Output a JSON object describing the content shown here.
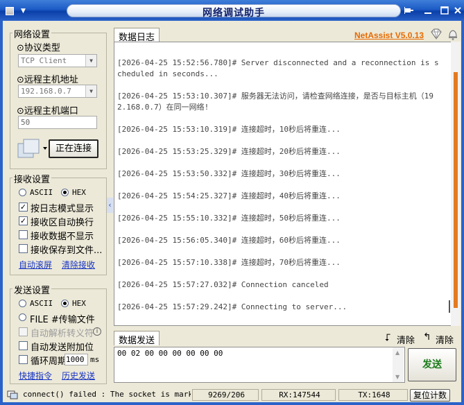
{
  "window": {
    "title": "网络调试助手",
    "brand": "NetAssist V5.0.13",
    "colors": {
      "titlebar": "#1c5bc6",
      "brand": "#e86a00",
      "send_button_text": "#1a7a1a",
      "link": "#1834c4"
    }
  },
  "network": {
    "title": "网络设置",
    "protocol_label": "⊙协议类型",
    "protocol_value": "TCP Client",
    "host_label": "⊙远程主机地址",
    "host_value": "192.168.0.7",
    "port_label": "⊙远程主机端口",
    "port_value": "50",
    "connect_button": "正在连接"
  },
  "receive": {
    "title": "接收设置",
    "ascii": "ASCII",
    "hex": "HEX",
    "opt_log_mode": "按日志模式显示",
    "opt_auto_wrap": "接收区自动换行",
    "opt_hide_data": "接收数据不显示",
    "opt_save_file": "接收保存到文件...",
    "link_auto_scroll": "自动滚屏",
    "link_clear": "清除接收"
  },
  "send": {
    "title": "发送设置",
    "ascii": "ASCII",
    "hex": "HEX",
    "file_label": "FILE #传输文件",
    "opt_escape": "自动解析转义符",
    "opt_append": "自动发送附加位",
    "opt_cycle": "循环周期",
    "cycle_value": "1000",
    "cycle_unit": "ms",
    "link_shortcuts": "快捷指令",
    "link_history": "历史发送"
  },
  "log": {
    "tab": "数据日志",
    "lines": [
      "[2026-04-25 15:52:56.780]# Server disconnected and a reconnection is scheduled in seconds...",
      "[2026-04-25 15:53:10.307]# 服务器无法访问，请检查网络连接，是否与目标主机（192.168.0.7）在同一网络!",
      "[2026-04-25 15:53:10.319]# 连接超时，10秒后将重连...",
      "[2026-04-25 15:53:25.329]# 连接超时，20秒后将重连...",
      "[2026-04-25 15:53:50.332]# 连接超时，30秒后将重连...",
      "[2026-04-25 15:54:25.327]# 连接超时，40秒后将重连...",
      "[2026-04-25 15:55:10.332]# 连接超时，50秒后将重连...",
      "[2026-04-25 15:56:05.340]# 连接超时，60秒后将重连...",
      "[2026-04-25 15:57:10.338]# 连接超时，70秒后将重连...",
      "[2026-04-25 15:57:27.032]# Connection canceled",
      "[2026-04-25 15:57:29.242]# Connecting to server..."
    ]
  },
  "sendpanel": {
    "tab": "数据发送",
    "clear1": "清除",
    "clear2": "清除",
    "content": "00 02 00 00 00 00 00 00",
    "send_button": "发送"
  },
  "statusbar": {
    "message": "connect() failed : The socket is marked",
    "counts": "9269/206",
    "rx": "RX:147544",
    "tx": "TX:1648",
    "reset": "复位计数"
  }
}
